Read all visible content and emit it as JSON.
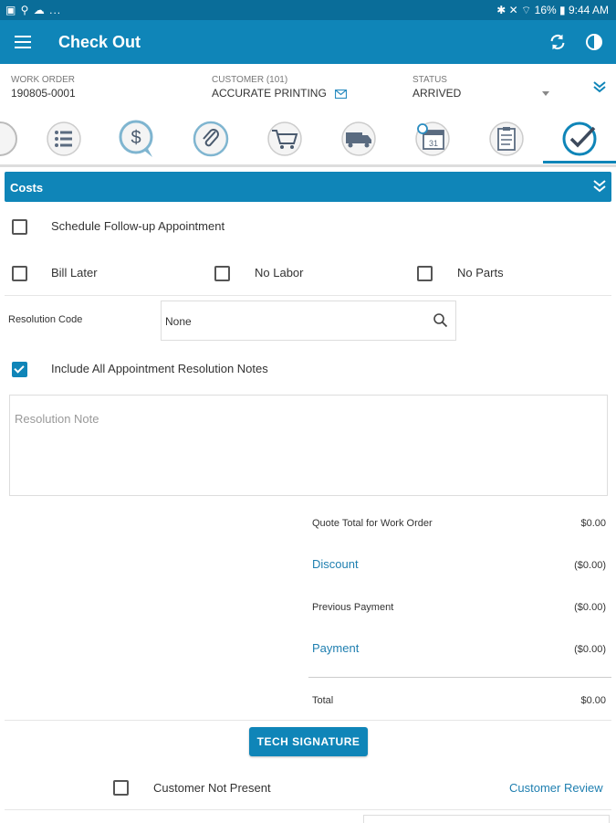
{
  "status_bar": {
    "left_icons": "▣ ⚲ ☁ ...",
    "right_text": "✱ ✕ ⌔ 16% ▮ 9:44 AM"
  },
  "app_bar": {
    "title": "Check Out"
  },
  "info": {
    "work_order_label": "WORK ORDER",
    "work_order_value": "190805-0001",
    "customer_label": "CUSTOMER (101)",
    "customer_value": "ACCURATE PRINTING",
    "status_label": "STATUS",
    "status_value": "ARRIVED"
  },
  "tabs": [
    {
      "icon": "clock-icon"
    },
    {
      "icon": "list-icon"
    },
    {
      "icon": "dollar-icon"
    },
    {
      "icon": "attachment-icon"
    },
    {
      "icon": "cart-icon"
    },
    {
      "icon": "truck-icon"
    },
    {
      "icon": "calendar-icon"
    },
    {
      "icon": "clipboard-icon"
    },
    {
      "icon": "checkmark-icon",
      "active": true
    }
  ],
  "section": {
    "title": "Costs"
  },
  "form": {
    "schedule_followup_label": "Schedule Follow-up Appointment",
    "bill_later_label": "Bill Later",
    "no_labor_label": "No Labor",
    "no_parts_label": "No Parts",
    "resolution_code_label": "Resolution Code",
    "resolution_code_value": "None",
    "include_notes_label": "Include All Appointment Resolution Notes",
    "include_notes_checked": true,
    "resolution_note_placeholder": "Resolution Note"
  },
  "totals": {
    "quote_total_label": "Quote Total for Work Order",
    "quote_total_value": "$0.00",
    "discount_label": "Discount",
    "discount_value": "($0.00)",
    "previous_payment_label": "Previous Payment",
    "previous_payment_value": "($0.00)",
    "payment_label": "Payment",
    "payment_value": "($0.00)",
    "total_label": "Total",
    "total_value": "$0.00"
  },
  "actions": {
    "tech_signature_label": "TECH SIGNATURE",
    "customer_not_present_label": "Customer Not Present",
    "customer_review_label": "Customer Review"
  },
  "colors": {
    "primary": "#0f85b8",
    "status_bar": "#0a6d99",
    "link": "#1f7fb0"
  }
}
